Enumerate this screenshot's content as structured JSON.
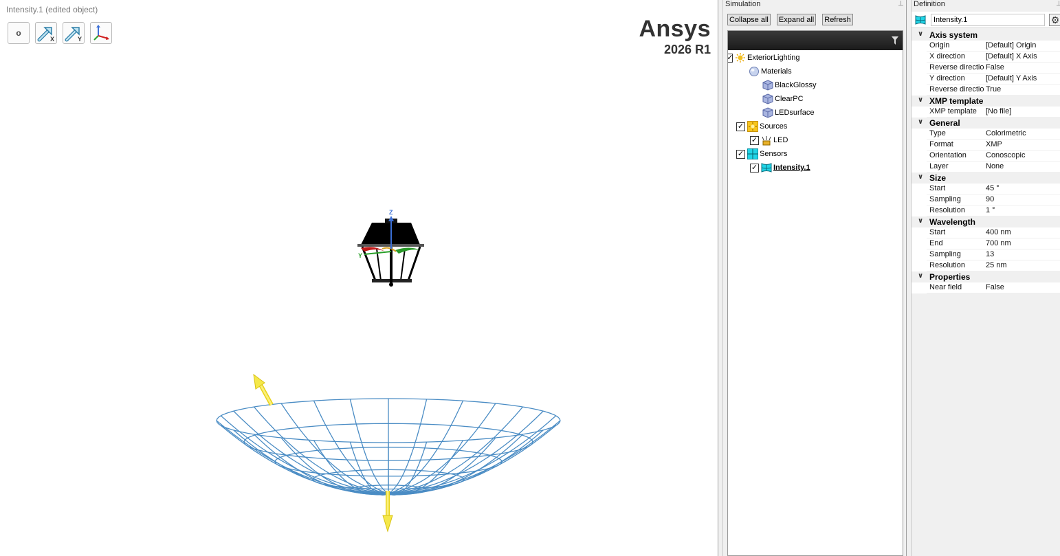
{
  "viewport": {
    "title": "Intensity.1 (edited object)",
    "toolbar": [
      {
        "name": "origin-button",
        "label": "o",
        "icon": "origin-point-icon"
      },
      {
        "name": "x-direction-button",
        "label": "X",
        "icon": "arrow-x-icon"
      },
      {
        "name": "y-direction-button",
        "label": "Y",
        "icon": "arrow-y-icon"
      },
      {
        "name": "axis-system-button",
        "label": "",
        "icon": "axis-triad-icon"
      }
    ],
    "brand": {
      "name": "Ansys",
      "version": "2026 R1"
    },
    "axis_labels": {
      "z": "Z",
      "y": "Y"
    }
  },
  "simulation": {
    "title": "Simulation",
    "buttons": {
      "collapse": "Collapse all",
      "expand": "Expand all",
      "refresh": "Refresh"
    },
    "tree": [
      {
        "label": "ExteriorLighting",
        "checked": true,
        "icon": "sun-icon"
      },
      {
        "label": "Materials",
        "icon": "material-sphere-icon"
      },
      {
        "label": "BlackGlossy",
        "icon": "material-cube-icon"
      },
      {
        "label": "ClearPC",
        "icon": "material-cube-icon"
      },
      {
        "label": "LEDsurface",
        "icon": "material-cube-icon"
      },
      {
        "label": "Sources",
        "checked": true,
        "icon": "sources-icon"
      },
      {
        "label": "LED",
        "checked": true,
        "icon": "led-source-icon"
      },
      {
        "label": "Sensors",
        "checked": true,
        "icon": "sensors-icon"
      },
      {
        "label": "Intensity.1",
        "checked": true,
        "icon": "intensity-sensor-icon",
        "selected": true
      }
    ]
  },
  "definition": {
    "title": "Definition",
    "object_name": "Intensity.1",
    "categories": [
      {
        "name": "Axis system",
        "rows": [
          {
            "name": "Origin",
            "value": "[Default] Origin"
          },
          {
            "name": "X direction",
            "value": "[Default] X Axis"
          },
          {
            "name": "Reverse direction",
            "value": "False"
          },
          {
            "name": "Y direction",
            "value": "[Default] Y Axis"
          },
          {
            "name": "Reverse direction",
            "value": "True"
          }
        ]
      },
      {
        "name": "XMP template",
        "rows": [
          {
            "name": "XMP template",
            "value": "[No file]"
          }
        ]
      },
      {
        "name": "General",
        "rows": [
          {
            "name": "Type",
            "value": "Colorimetric"
          },
          {
            "name": "Format",
            "value": "XMP"
          },
          {
            "name": "Orientation",
            "value": "Conoscopic"
          },
          {
            "name": "Layer",
            "value": "None"
          }
        ]
      },
      {
        "name": "Size",
        "rows": [
          {
            "name": "Start",
            "value": "45 °"
          },
          {
            "name": "Sampling",
            "value": "90"
          },
          {
            "name": "Resolution",
            "value": "1 °"
          }
        ]
      },
      {
        "name": "Wavelength",
        "rows": [
          {
            "name": "Start",
            "value": "400 nm"
          },
          {
            "name": "End",
            "value": "700 nm"
          },
          {
            "name": "Sampling",
            "value": "13"
          },
          {
            "name": "Resolution",
            "value": "25 nm"
          }
        ]
      },
      {
        "name": "Properties",
        "rows": [
          {
            "name": "Near field",
            "value": "False"
          }
        ]
      }
    ]
  },
  "colors": {
    "mesh": "#4a8cc4",
    "arrow": "#f5e84a",
    "axis_z": "#3b6fd6",
    "axis_y": "#2aa02a",
    "axis_x": "#d02020"
  }
}
